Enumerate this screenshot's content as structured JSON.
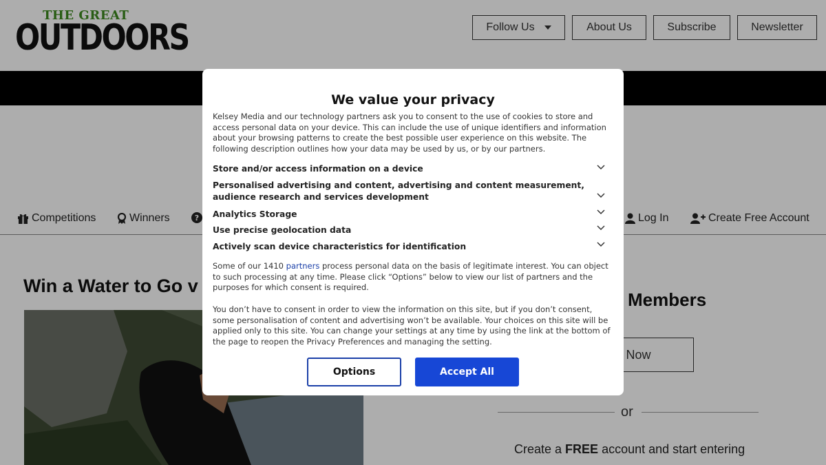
{
  "site": {
    "logo_small": "THE GREAT",
    "logo_big": "OUTDOORS",
    "top_buttons": [
      "Follow Us",
      "About Us",
      "Subscribe",
      "Newsletter"
    ]
  },
  "nav": {
    "items": [
      "Competitions",
      "Winners",
      "Log In",
      "Create Free Account"
    ]
  },
  "article": {
    "title": "Win a Water to Go v"
  },
  "sidebar": {
    "members_heading": "Members",
    "signin_label": "n Now",
    "or_text": "or",
    "create_pre": "Create a ",
    "create_bold": "FREE",
    "create_post": " account and start entering"
  },
  "consent": {
    "title": "We value your privacy",
    "intro": "Kelsey Media and our technology partners ask you to consent to the use of cookies to store and access personal data on your device. This can include the use of unique identifiers and information about your browsing patterns to create the best possible user experience on this website. The following description outlines how your data may be used by us, or by our partners.",
    "purposes": [
      "Store and/or access information on a device",
      "Personalised advertising and content, advertising and content measurement, audience research and services development",
      "Analytics Storage",
      "Use precise geolocation data",
      "Actively scan device characteristics for identification"
    ],
    "legit_pre": "Some of our 1410 ",
    "legit_link": "partners",
    "legit_post": " process personal data on the basis of legitimate interest. You can object to such processing at any time. Please click “Options” below to view our list of partners and the purposes for which consent is required.",
    "no_consent": "You don’t have to consent in order to view the information on this site, but if you don’t consent, some personalisation of content and advertising won’t be available. Your choices on this site will be applied only to this site. You can change your settings at any time by using the link at the bottom of the page to reopen the Privacy Preferences and managing the setting.",
    "options_label": "Options",
    "accept_label": "Accept All"
  },
  "colors": {
    "accent": "#1747d6",
    "logo_green": "#3d8a1e"
  }
}
